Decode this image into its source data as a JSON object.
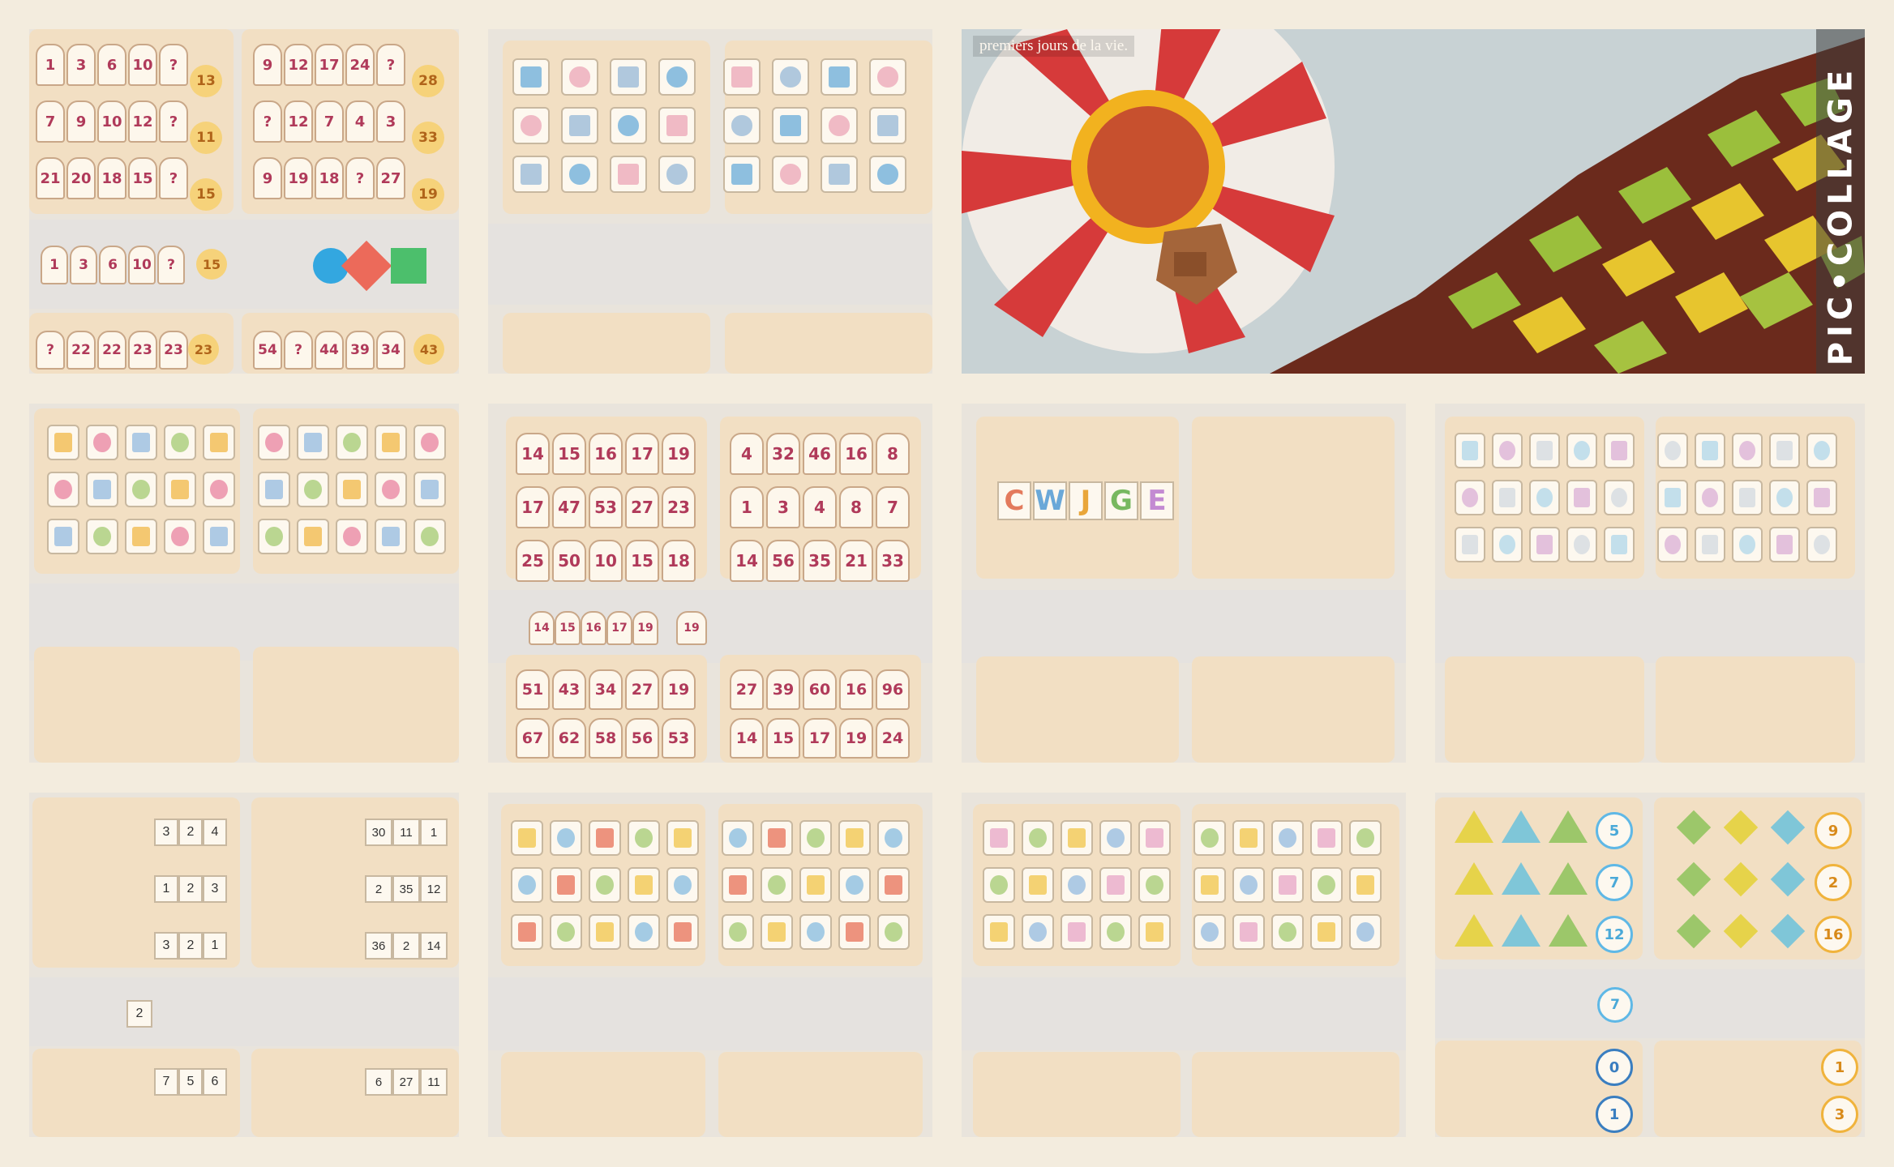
{
  "puzzle1": {
    "rows": [
      {
        "cards": [
          "1",
          "3",
          "6",
          "10",
          "?"
        ],
        "answer": "13"
      },
      {
        "cards": [
          "7",
          "9",
          "10",
          "12",
          "?"
        ],
        "answer": "11"
      },
      {
        "cards": [
          "21",
          "20",
          "18",
          "15",
          "?"
        ],
        "answer": "15"
      }
    ],
    "rows_right": [
      {
        "cards": [
          "9",
          "12",
          "17",
          "24",
          "?"
        ],
        "answer": "28"
      },
      {
        "cards": [
          "?",
          "12",
          "7",
          "4",
          "3"
        ],
        "answer": "33"
      },
      {
        "cards": [
          "9",
          "19",
          "18",
          "?",
          "27"
        ],
        "answer": "19"
      }
    ],
    "example": {
      "cards": [
        "1",
        "3",
        "6",
        "10",
        "?"
      ],
      "answer": "15"
    },
    "bottom_left": {
      "cards": [
        "?",
        "22",
        "22",
        "23",
        "23"
      ],
      "answer": "23"
    },
    "bottom_right": {
      "cards": [
        "54",
        "?",
        "44",
        "39",
        "34"
      ],
      "answer": "43"
    }
  },
  "puzzle4": {
    "rows": [
      {
        "cards": [
          "14",
          "15",
          "16",
          "17",
          "19"
        ]
      },
      {
        "cards": [
          "17",
          "47",
          "53",
          "27",
          "23"
        ]
      },
      {
        "cards": [
          "25",
          "50",
          "10",
          "15",
          "18"
        ]
      }
    ],
    "rows_right": [
      {
        "cards": [
          "4",
          "32",
          "46",
          "16",
          "8"
        ]
      },
      {
        "cards": [
          "1",
          "3",
          "4",
          "8",
          "7"
        ]
      },
      {
        "cards": [
          "14",
          "56",
          "35",
          "21",
          "33"
        ]
      }
    ],
    "example": {
      "cards": [
        "14",
        "15",
        "16",
        "17",
        "19"
      ],
      "answer": "19"
    },
    "bottom_left": [
      [
        "51",
        "43",
        "34",
        "27",
        "19"
      ],
      [
        "67",
        "62",
        "58",
        "56",
        "53"
      ]
    ],
    "bottom_right": [
      [
        "27",
        "39",
        "60",
        "16",
        "96"
      ],
      [
        "14",
        "15",
        "17",
        "19",
        "24"
      ]
    ]
  },
  "puzzle5": {
    "letters": [
      "C",
      "W",
      "J",
      "G",
      "E"
    ]
  },
  "puzzle9": {
    "rows": [
      [
        "3",
        "2",
        "4"
      ],
      [
        "1",
        "2",
        "3"
      ],
      [
        "3",
        "2",
        "1"
      ]
    ],
    "rows_right": [
      [
        "30",
        "11",
        "1"
      ],
      [
        "2",
        "35",
        "12"
      ],
      [
        "36",
        "2",
        "14"
      ]
    ],
    "example": "2",
    "bottom": [
      [
        "7",
        "5",
        "6"
      ],
      [
        "6",
        "27",
        "11"
      ]
    ]
  },
  "puzzle12": {
    "answers": [
      "5",
      "7",
      "12"
    ],
    "answers_right": [
      "9",
      "2",
      "16"
    ],
    "example": "7",
    "bottom": [
      "0",
      "1",
      "1",
      "3"
    ]
  },
  "balloon": {
    "caption": "premiers jours de la vie.",
    "watermark": "PIC•COLLAGE"
  },
  "colors": {
    "background": "#f3ecde",
    "card_text": "#b03a5a",
    "sheet": "#f2dfc3",
    "lane": "#e5e2df",
    "circle_yellow": "#f6d27a",
    "circle_blue": "#5fb8e6"
  }
}
